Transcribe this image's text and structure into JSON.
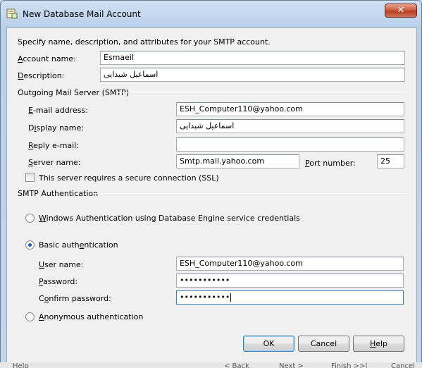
{
  "window": {
    "title": "New Database Mail Account",
    "close_glyph": "✕"
  },
  "intro": "Specify name, description, and attributes for your SMTP account.",
  "account": {
    "name_label": "Account name:",
    "name_label_key": "A",
    "name_label_rest": "ccount name:",
    "name_value": "Esmaeil",
    "desc_label_key": "D",
    "desc_label_rest": "escription:",
    "desc_value": "اسماعیل شیدایی"
  },
  "smtp": {
    "group_label": "Outgoing Mail Server (SMTP)",
    "email_label_key": "E",
    "email_label_rest": "-mail address:",
    "email_value": "ESH_Computer110@yahoo.com",
    "display_label_pre": "D",
    "display_label_key": "i",
    "display_label_rest": "splay name:",
    "display_value": "اسماعیل شیدایی",
    "reply_label_key": "R",
    "reply_label_rest": "eply e-mail:",
    "reply_value": "",
    "server_label_key": "S",
    "server_label_rest": "erver name:",
    "server_value": "Smtp.mail.yahoo.com",
    "port_label_key": "P",
    "port_label_rest": "ort number:",
    "port_value": "25",
    "ssl_label": "This server requires a secure connection (SSL)",
    "ssl_checked": false
  },
  "auth": {
    "group_label": "SMTP Authentication",
    "windows_label_key": "W",
    "windows_label_rest": "indows Authentication using Database Engine service credentials",
    "basic_label_pre": "Basic auth",
    "basic_label_key": "e",
    "basic_label_rest": "ntication",
    "user_label_key": "U",
    "user_label_rest": "ser name:",
    "user_value": "ESH_Computer110@yahoo.com",
    "password_label_key": "P",
    "password_label_rest": "assword:",
    "password_value": "•••••••••••",
    "confirm_label_pre": "C",
    "confirm_label_key": "o",
    "confirm_label_rest": "nfirm password:",
    "confirm_value": "•••••••••••",
    "anon_label_key": "A",
    "anon_label_rest": "nonymous authentication",
    "selected": "basic"
  },
  "buttons": {
    "ok": "OK",
    "cancel": "Cancel",
    "help_key": "H",
    "help_rest": "elp"
  },
  "background_strip": [
    "Help",
    "< Back",
    "Next >",
    "Finish >>|",
    "Cancel"
  ]
}
